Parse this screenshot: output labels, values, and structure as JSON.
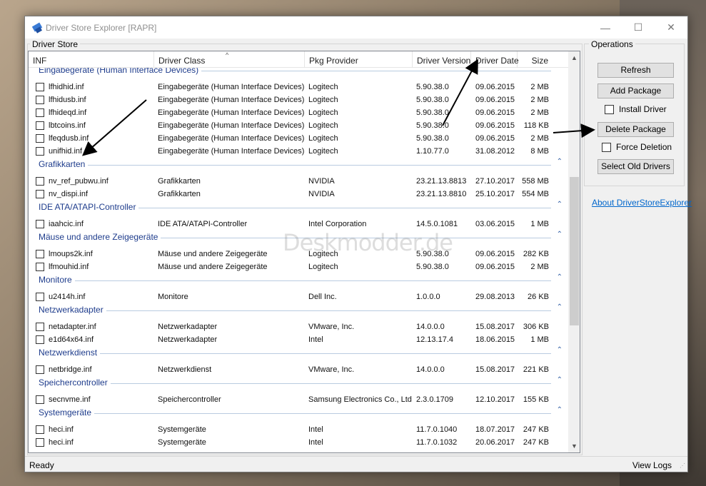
{
  "window": {
    "title": "Driver Store Explorer [RAPR]",
    "minimize_glyph": "—",
    "maximize_glyph": "☐",
    "close_glyph": "✕"
  },
  "driver_store": {
    "group_title": "Driver Store",
    "columns": [
      "INF",
      "Driver Class",
      "Pkg Provider",
      "Driver Version",
      "Driver Date",
      "Size"
    ],
    "sort_glyph": "^",
    "groups": [
      {
        "name": "Eingabegeräte (Human Interface Devices)",
        "collapse": "⌃",
        "rows": [
          [
            "lfhidhid.inf",
            "Eingabegeräte (Human Interface Devices)",
            "Logitech",
            "5.90.38.0",
            "09.06.2015",
            "2 MB"
          ],
          [
            "lfhidusb.inf",
            "Eingabegeräte (Human Interface Devices)",
            "Logitech",
            "5.90.38.0",
            "09.06.2015",
            "2 MB"
          ],
          [
            "lfhideqd.inf",
            "Eingabegeräte (Human Interface Devices)",
            "Logitech",
            "5.90.38.0",
            "09.06.2015",
            "2 MB"
          ],
          [
            "lbtcoins.inf",
            "Eingabegeräte (Human Interface Devices)",
            "Logitech",
            "5.90.38.0",
            "09.06.2015",
            "118 KB"
          ],
          [
            "lfeqdusb.inf",
            "Eingabegeräte (Human Interface Devices)",
            "Logitech",
            "5.90.38.0",
            "09.06.2015",
            "2 MB"
          ],
          [
            "unifhid.inf",
            "Eingabegeräte (Human Interface Devices)",
            "Logitech",
            "1.10.77.0",
            "31.08.2012",
            "8 MB"
          ]
        ]
      },
      {
        "name": "Grafikkarten",
        "collapse": "⌃",
        "rows": [
          [
            "nv_ref_pubwu.inf",
            "Grafikkarten",
            "NVIDIA",
            "23.21.13.8813",
            "27.10.2017",
            "558 MB"
          ],
          [
            "nv_dispi.inf",
            "Grafikkarten",
            "NVIDIA",
            "23.21.13.8810",
            "25.10.2017",
            "554 MB"
          ]
        ]
      },
      {
        "name": "IDE ATA/ATAPI-Controller",
        "collapse": "⌃",
        "rows": [
          [
            "iaahcic.inf",
            "IDE ATA/ATAPI-Controller",
            "Intel Corporation",
            "14.5.0.1081",
            "03.06.2015",
            "1 MB"
          ]
        ]
      },
      {
        "name": "Mäuse und andere Zeigegeräte",
        "collapse": "⌃",
        "rows": [
          [
            "lmoups2k.inf",
            "Mäuse und andere Zeigegeräte",
            "Logitech",
            "5.90.38.0",
            "09.06.2015",
            "282 KB"
          ],
          [
            "lfmouhid.inf",
            "Mäuse und andere Zeigegeräte",
            "Logitech",
            "5.90.38.0",
            "09.06.2015",
            "2 MB"
          ]
        ]
      },
      {
        "name": "Monitore",
        "collapse": "⌃",
        "rows": [
          [
            "u2414h.inf",
            "Monitore",
            "Dell Inc.",
            "1.0.0.0",
            "29.08.2013",
            "26 KB"
          ]
        ]
      },
      {
        "name": "Netzwerkadapter",
        "collapse": "⌃",
        "rows": [
          [
            "netadapter.inf",
            "Netzwerkadapter",
            "VMware, Inc.",
            "14.0.0.0",
            "15.08.2017",
            "306 KB"
          ],
          [
            "e1d64x64.inf",
            "Netzwerkadapter",
            "Intel",
            "12.13.17.4",
            "18.06.2015",
            "1 MB"
          ]
        ]
      },
      {
        "name": "Netzwerkdienst",
        "collapse": "⌃",
        "rows": [
          [
            "netbridge.inf",
            "Netzwerkdienst",
            "VMware, Inc.",
            "14.0.0.0",
            "15.08.2017",
            "221 KB"
          ]
        ]
      },
      {
        "name": "Speichercontroller",
        "collapse": "⌃",
        "rows": [
          [
            "secnvme.inf",
            "Speichercontroller",
            "Samsung Electronics Co., Ltd",
            "2.3.0.1709",
            "12.10.2017",
            "155 KB"
          ]
        ]
      },
      {
        "name": "Systemgeräte",
        "collapse": "⌃",
        "rows": [
          [
            "heci.inf",
            "Systemgeräte",
            "Intel",
            "11.7.0.1040",
            "18.07.2017",
            "247 KB"
          ],
          [
            "heci.inf",
            "Systemgeräte",
            "Intel",
            "11.7.0.1032",
            "20.06.2017",
            "247 KB"
          ]
        ]
      }
    ]
  },
  "scrollbar": {
    "up": "▲",
    "down": "▼"
  },
  "operations": {
    "group_title": "Operations",
    "refresh": "Refresh",
    "add_package": "Add Package",
    "install_driver": "Install Driver",
    "delete_package": "Delete Package",
    "force_deletion": "Force Deletion",
    "select_old_drivers": "Select Old Drivers",
    "about_link": "About DriverStoreExplorer"
  },
  "status": {
    "text": "Ready",
    "view_logs": "View Logs",
    "grip": "⋰"
  },
  "watermark": "Deskmodder.de",
  "colors": {
    "group_header": "#1e3c8c",
    "link": "#0066cc",
    "accent": "#3562a8"
  }
}
